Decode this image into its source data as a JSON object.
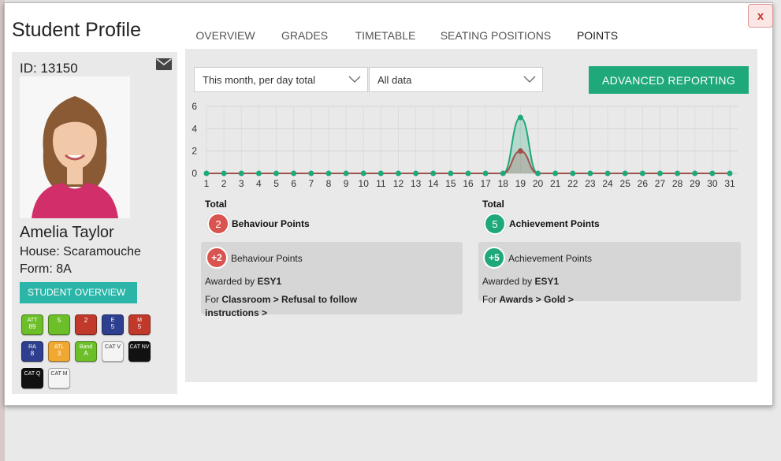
{
  "title": "Student Profile",
  "close_label": "x",
  "tabs": [
    {
      "label": "OVERVIEW"
    },
    {
      "label": "GRADES"
    },
    {
      "label": "TIMETABLE"
    },
    {
      "label": "SEATING POSITIONS"
    },
    {
      "label": "POINTS"
    }
  ],
  "student": {
    "id_text": "ID: 13150",
    "name": "Amelia Taylor",
    "house": "House: Scaramouche",
    "form": "Form: 8A",
    "overview_button": "STUDENT OVERVIEW"
  },
  "badges": [
    {
      "label": "ATT",
      "value": "89",
      "color": "#6dbf2a"
    },
    {
      "label": "",
      "value": "5",
      "color": "#6dbf2a"
    },
    {
      "label": "",
      "value": "2",
      "color": "#c0392b"
    },
    {
      "label": "E",
      "value": "5",
      "color": "#2e3f8f"
    },
    {
      "label": "M",
      "value": "5",
      "color": "#c0392b"
    },
    {
      "label": "RA",
      "value": "8",
      "color": "#2e3f8f"
    },
    {
      "label": "ATL",
      "value": "3",
      "color": "#f0a830"
    },
    {
      "label": "Band",
      "value": "A",
      "color": "#6dbf2a"
    },
    {
      "label": "CAT V",
      "value": "",
      "color": "#f4f4f4"
    },
    {
      "label": "CAT NV",
      "value": "",
      "color": "#111111"
    },
    {
      "label": "CAT Q",
      "value": "",
      "color": "#111111"
    },
    {
      "label": "CAT M",
      "value": "",
      "color": "#f4f4f4"
    }
  ],
  "filters": {
    "period": "This month, per day total",
    "data": "All data"
  },
  "advanced_button": "ADVANCED REPORTING",
  "chart_data": {
    "type": "line",
    "x": [
      1,
      2,
      3,
      4,
      5,
      6,
      7,
      8,
      9,
      10,
      11,
      12,
      13,
      14,
      15,
      16,
      17,
      18,
      19,
      20,
      21,
      22,
      23,
      24,
      25,
      26,
      27,
      28,
      29,
      30,
      31
    ],
    "series": [
      {
        "values": [
          0,
          0,
          0,
          0,
          0,
          0,
          0,
          0,
          0,
          0,
          0,
          0,
          0,
          0,
          0,
          0,
          0,
          0,
          5,
          0,
          0,
          0,
          0,
          0,
          0,
          0,
          0,
          0,
          0,
          0,
          0
        ],
        "color": "#1fa97a"
      },
      {
        "values": [
          0,
          0,
          0,
          0,
          0,
          0,
          0,
          0,
          0,
          0,
          0,
          0,
          0,
          0,
          0,
          0,
          0,
          0,
          2,
          0,
          0,
          0,
          0,
          0,
          0,
          0,
          0,
          0,
          0,
          0,
          0
        ],
        "color": "#a0524a"
      }
    ],
    "yticks": [
      "0",
      "2",
      "4",
      "6"
    ],
    "ylim": [
      0,
      6
    ],
    "grid": true
  },
  "totals": {
    "behaviour": {
      "heading": "Total",
      "count": "2",
      "label": "Behaviour Points"
    },
    "achievement": {
      "heading": "Total",
      "count": "5",
      "label": "Achievement Points"
    }
  },
  "cards": {
    "behaviour": {
      "points": "+2",
      "title": "Behaviour Points",
      "awarded_prefix": "Awarded by",
      "awarded_by": "ESY1",
      "for_prefix": "For",
      "for_text": "Classroom > Refusal to follow instructions >"
    },
    "achievement": {
      "points": "+5",
      "title": "Achievement Points",
      "awarded_prefix": "Awarded by",
      "awarded_by": "ESY1",
      "for_prefix": "For",
      "for_text": "Awards > Gold >"
    }
  },
  "colors": {
    "accent": "#1fa97a",
    "teal": "#2bb5a8",
    "behaviour": "#d9534f"
  }
}
